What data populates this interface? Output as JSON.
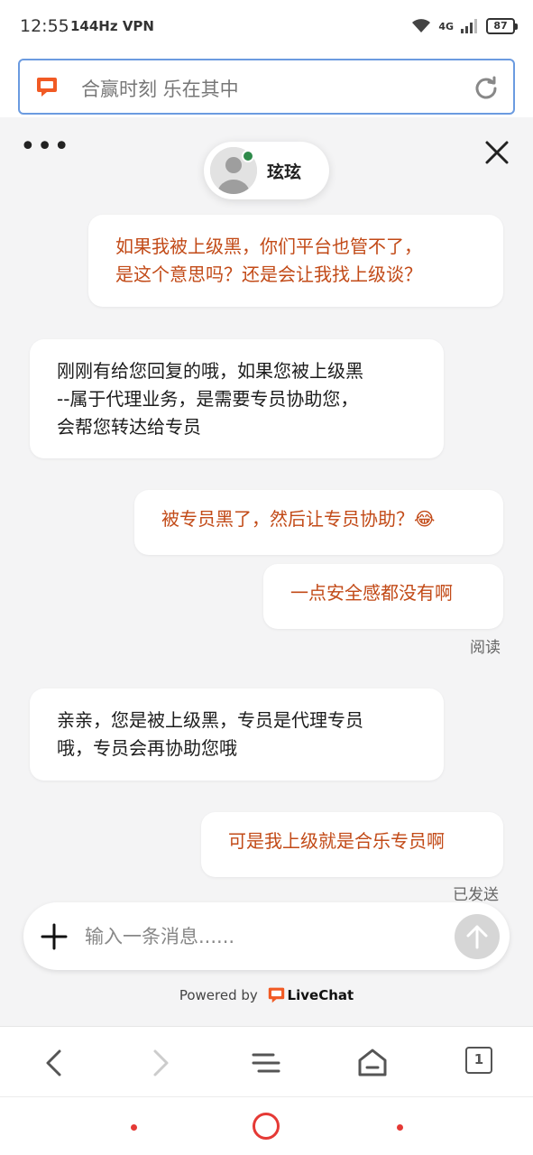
{
  "status_bar": {
    "time": "12:55",
    "left_icons": "144Hz VPN",
    "network": "4G",
    "battery": "87"
  },
  "url_bar": {
    "title": "合赢时刻 乐在其中",
    "reload_icon": "reload-icon",
    "site_icon": "chat-bubble-icon"
  },
  "chat": {
    "agent_name": "玹玹",
    "agent_status_color": "#2e8a4a",
    "messages": [
      {
        "from": "visitor",
        "lines": [
          "如果我被上级黑，你们平台也管不了，",
          "是这个意思吗？还是会让我找上级谈？"
        ]
      },
      {
        "from": "agent",
        "lines": [
          "刚刚有给您回复的哦，如果您被上级黑",
          "--属于代理业务，是需要专员协助您，",
          "会帮您转达给专员"
        ]
      },
      {
        "from": "visitor",
        "lines": [
          "被专员黑了，然后让专员协助？😂"
        ]
      },
      {
        "from": "visitor",
        "lines": [
          "一点安全感都没有啊"
        ],
        "status": "阅读"
      },
      {
        "from": "agent",
        "lines": [
          "亲亲，您是被上级黑，专员是代理专员",
          "哦，专员会再协助您哦"
        ]
      },
      {
        "from": "visitor",
        "lines": [
          "可是我上级就是合乐专员啊"
        ],
        "status": "已发送"
      }
    ],
    "composer_placeholder": "输入一条消息......",
    "powered_by": "Powered by",
    "brand": "LiveChat"
  },
  "colors": {
    "visitor_text": "#c24a17",
    "accent": "#f15a24",
    "url_border": "#6b9be0",
    "system_nav": "#e53935"
  },
  "browser_nav": {
    "tab_count": "1"
  }
}
